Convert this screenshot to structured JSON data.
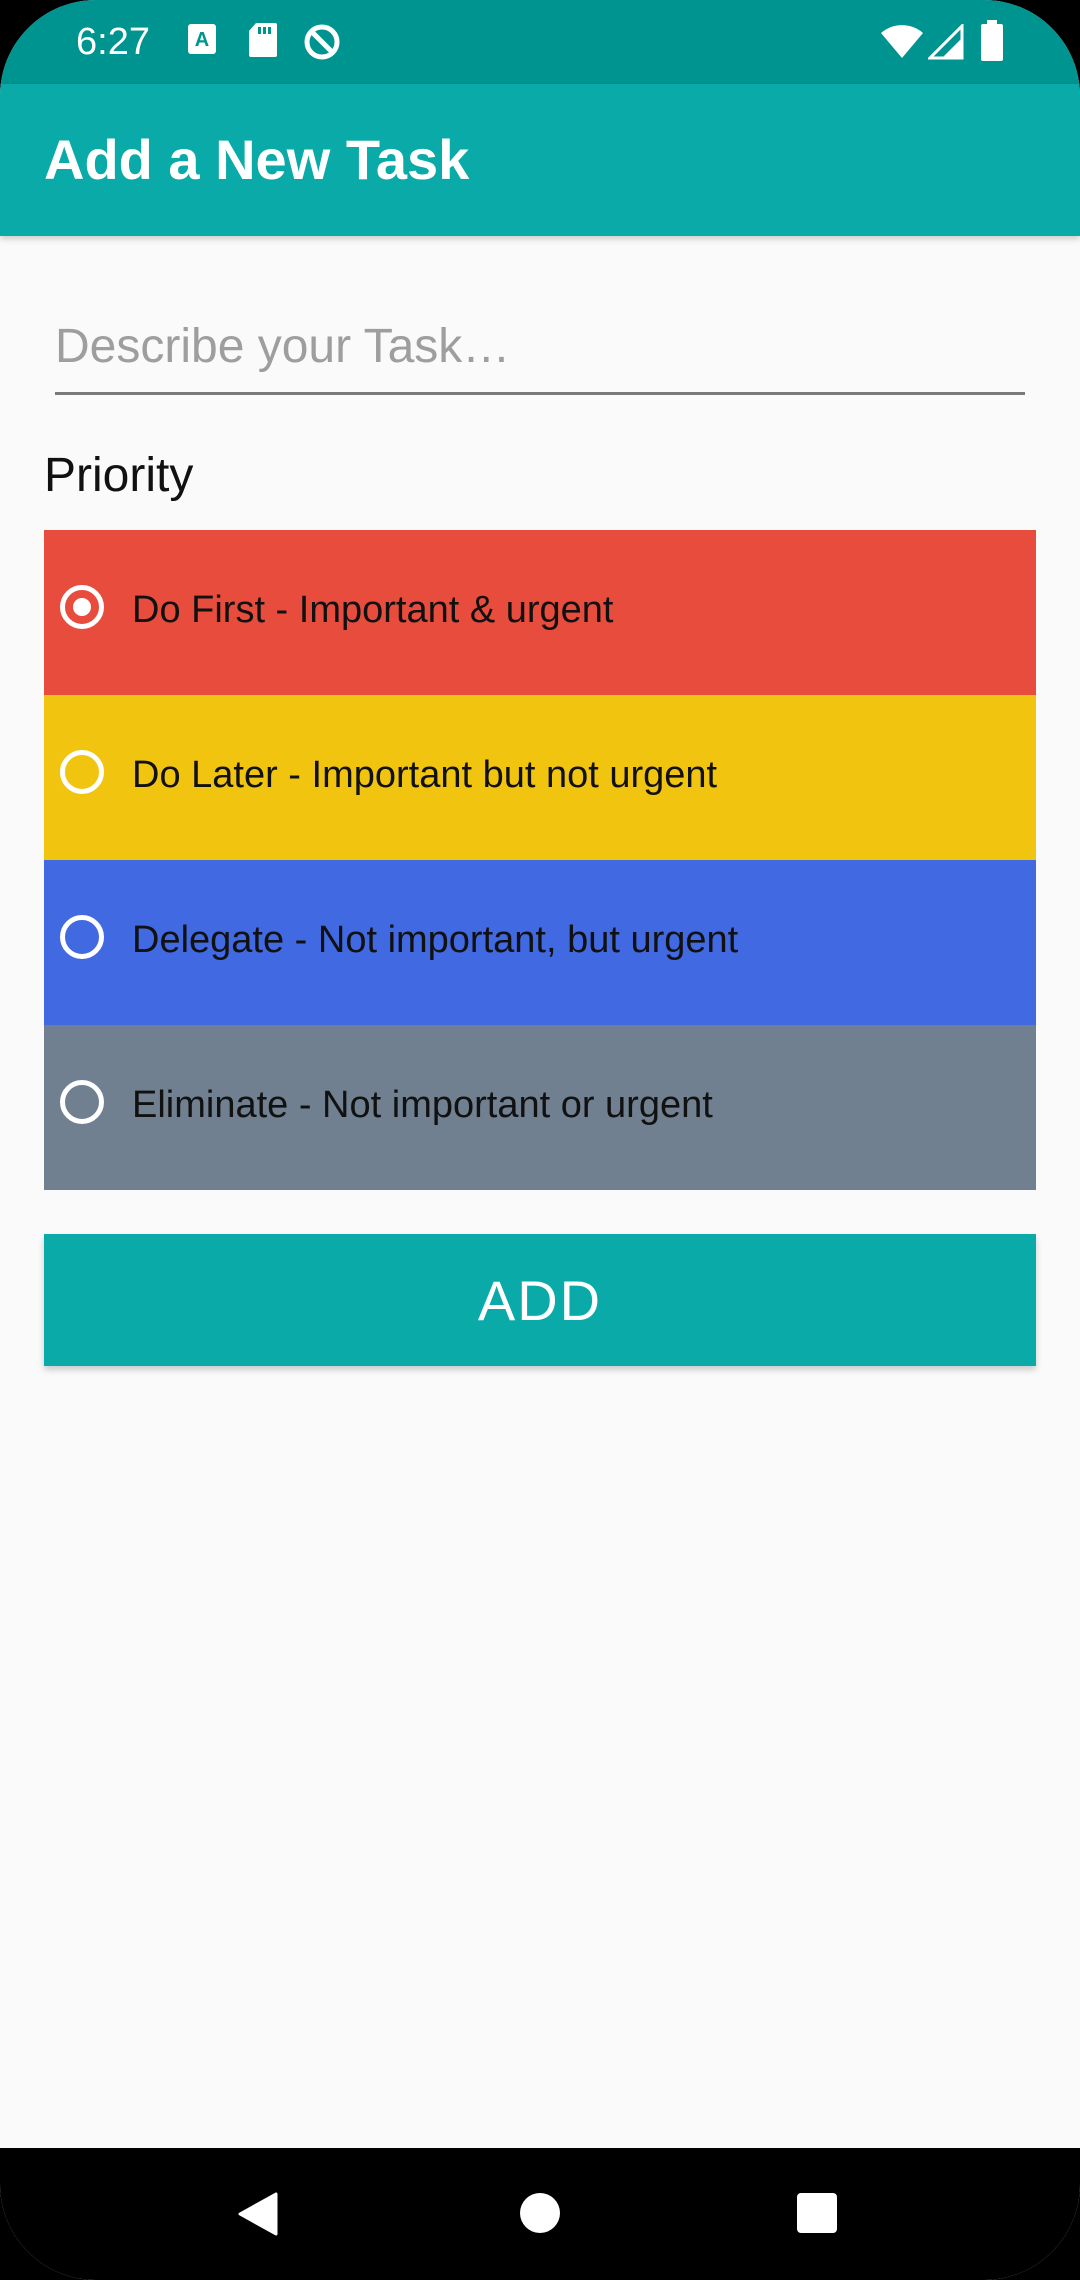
{
  "status_bar": {
    "time": "6:27",
    "left_icons": [
      "keyboard-a-icon",
      "sd-card-icon",
      "data-saver-icon"
    ],
    "right_icons": [
      "wifi-icon",
      "cell-signal-icon",
      "battery-icon"
    ]
  },
  "app_bar": {
    "title": "Add a New Task"
  },
  "task_input": {
    "value": "",
    "placeholder": "Describe your Task…"
  },
  "priority": {
    "label": "Priority",
    "options": [
      {
        "label": "Do First - Important & urgent",
        "color": "#e74c3c",
        "selected": true
      },
      {
        "label": "Do Later - Important but not urgent",
        "color": "#f1c40f",
        "selected": false
      },
      {
        "label": "Delegate - Not important, but urgent",
        "color": "#4169e1",
        "selected": false
      },
      {
        "label": "Eliminate - Not important or urgent",
        "color": "#708090",
        "selected": false
      }
    ]
  },
  "add_button": {
    "label": "ADD"
  },
  "colors": {
    "status_bar": "#009490",
    "app_bar": "#0aaaa8",
    "button": "#0aaaa8",
    "background": "#fafafa"
  },
  "nav_bar": {
    "icons": [
      "back-icon",
      "home-icon",
      "recents-icon"
    ]
  }
}
